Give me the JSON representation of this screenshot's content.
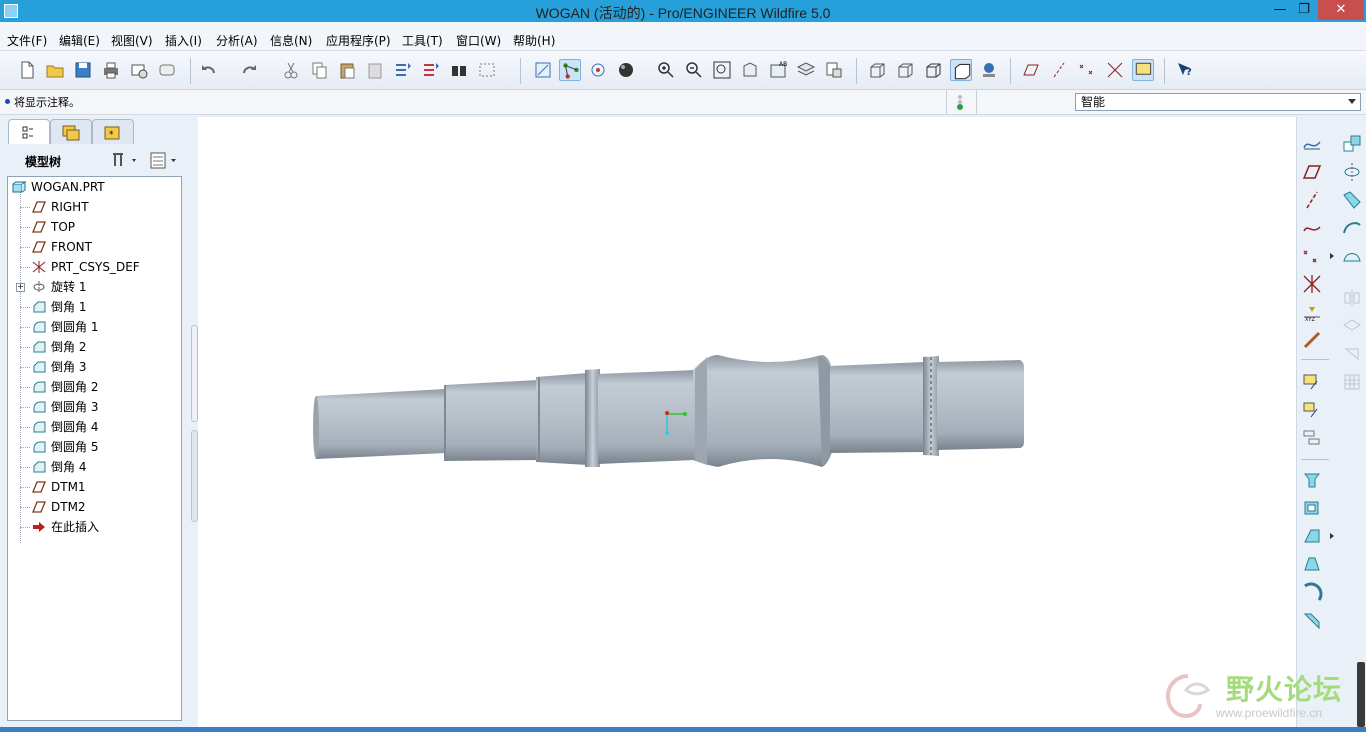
{
  "window": {
    "title": "WOGAN (活动的) - Pro/ENGINEER Wildfire 5.0",
    "min_glyph": "—",
    "max_glyph": "❐",
    "close_glyph": "✕"
  },
  "menu": [
    "文件(F)",
    "编辑(E)",
    "视图(V)",
    "插入(I)",
    "分析(A)",
    "信息(N)",
    "应用程序(P)",
    "工具(T)",
    "窗口(W)",
    "帮助(H)"
  ],
  "message": "将显示注释。",
  "filter": {
    "value": "智能"
  },
  "model_tree": {
    "header": "模型树",
    "items": [
      {
        "label": "WOGAN.PRT",
        "icon": "part-icon"
      },
      {
        "label": "RIGHT",
        "icon": "datum-plane-icon"
      },
      {
        "label": "TOP",
        "icon": "datum-plane-icon"
      },
      {
        "label": "FRONT",
        "icon": "datum-plane-icon"
      },
      {
        "label": "PRT_CSYS_DEF",
        "icon": "csys-icon"
      },
      {
        "label": "旋转 1",
        "icon": "revolve-icon"
      },
      {
        "label": "倒角 1",
        "icon": "chamfer-icon"
      },
      {
        "label": "倒圆角 1",
        "icon": "round-icon"
      },
      {
        "label": "倒角 2",
        "icon": "chamfer-icon"
      },
      {
        "label": "倒角 3",
        "icon": "chamfer-icon"
      },
      {
        "label": "倒圆角 2",
        "icon": "round-icon"
      },
      {
        "label": "倒圆角 3",
        "icon": "round-icon"
      },
      {
        "label": "倒圆角 4",
        "icon": "round-icon"
      },
      {
        "label": "倒圆角 5",
        "icon": "round-icon"
      },
      {
        "label": "倒角 4",
        "icon": "chamfer-icon"
      },
      {
        "label": "DTM1",
        "icon": "datum-plane-icon"
      },
      {
        "label": "DTM2",
        "icon": "datum-plane-icon"
      },
      {
        "label": "在此插入",
        "icon": "insert-here-arrow-icon"
      }
    ]
  },
  "watermark": {
    "title": "野火论坛",
    "url": "www.proewildfire.cn"
  },
  "colors": {
    "titlebar": "#26a0da",
    "accent": "#1a44c8",
    "model": "#b3bcc6"
  }
}
